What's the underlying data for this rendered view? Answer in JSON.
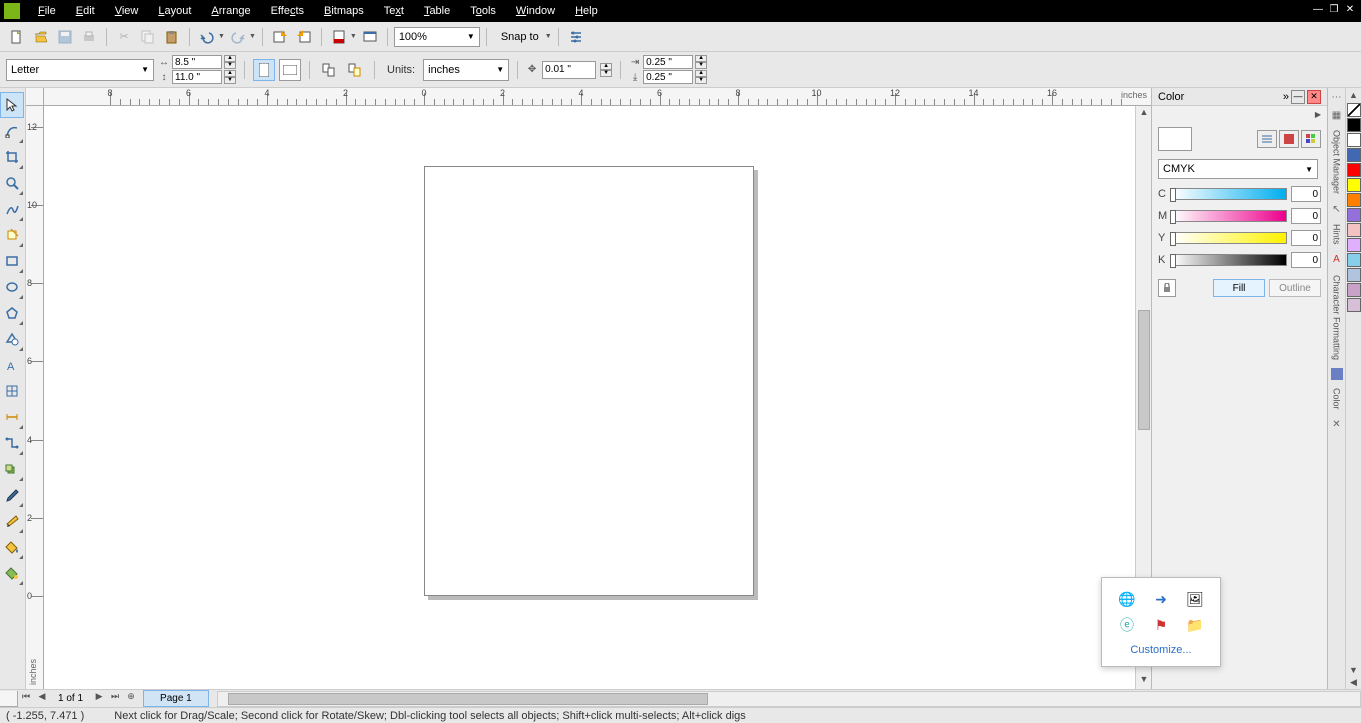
{
  "menu": {
    "file": "File",
    "edit": "Edit",
    "view": "View",
    "layout": "Layout",
    "arrange": "Arrange",
    "effects": "Effects",
    "bitmaps": "Bitmaps",
    "text": "Text",
    "table": "Table",
    "tools": "Tools",
    "window": "Window",
    "help": "Help"
  },
  "toolbar1": {
    "zoom": "100%",
    "snap": "Snap to"
  },
  "toolbar2": {
    "paper": "Letter",
    "width": "8.5 \"",
    "height": "11.0 \"",
    "units_label": "Units:",
    "units": "inches",
    "nudge": "0.01 \"",
    "dup_x": "0.25 \"",
    "dup_y": "0.25 \""
  },
  "ruler_unit": "inches",
  "pagebar": {
    "count": "1 of 1",
    "tab": "Page 1"
  },
  "status": {
    "coords": "( -1.255, 7.471 )",
    "hint": "Next click for Drag/Scale; Second click for Rotate/Skew; Dbl-clicking tool selects all objects; Shift+click multi-selects; Alt+click digs"
  },
  "docker": {
    "title": "Color",
    "model": "CMYK",
    "c_label": "C",
    "c_val": "0",
    "m_label": "M",
    "m_val": "0",
    "y_label": "Y",
    "y_val": "0",
    "k_label": "K",
    "k_val": "0",
    "fill": "Fill",
    "outline": "Outline"
  },
  "tabs": {
    "obj": "Object Manager",
    "hints": "Hints",
    "char": "Character Formatting",
    "color": "Color"
  },
  "tray": {
    "customize": "Customize..."
  },
  "palette": [
    "#000000",
    "#ffffff",
    "#4169b2",
    "#ff0000",
    "#ffff00",
    "#ff7f00",
    "#9370db",
    "#f4c2c2",
    "#e0b0ff",
    "#87ceeb",
    "#b0c4de",
    "#c8a2c8",
    "#d8bfd8"
  ]
}
